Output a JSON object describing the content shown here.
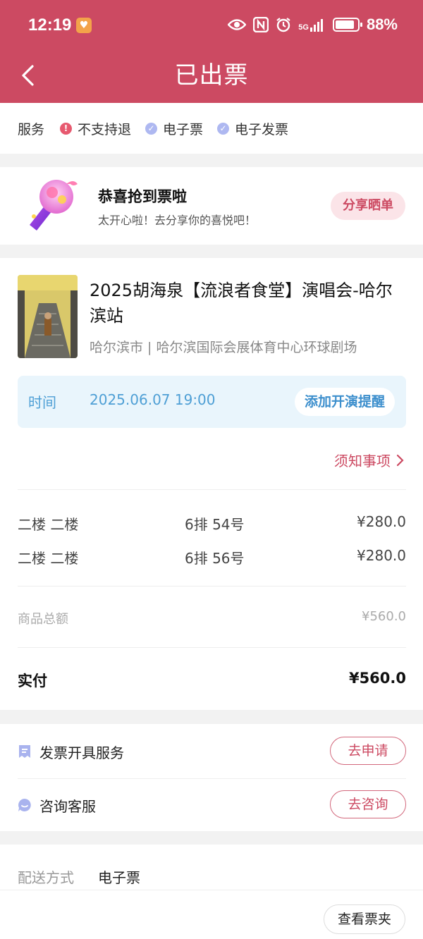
{
  "status_bar": {
    "time": "12:19",
    "network": "5G",
    "battery_percent": "88%",
    "battery_level": 0.88
  },
  "nav": {
    "title": "已出票",
    "back_icon": "chevron-left-icon"
  },
  "services_bar": {
    "label": "服务",
    "items": [
      {
        "text": "不支持退",
        "icon": "alert-icon",
        "color": "#e7596f"
      },
      {
        "text": "电子票",
        "icon": "check-icon",
        "color": "#aeb8f1"
      },
      {
        "text": "电子发票",
        "icon": "check-icon",
        "color": "#aeb8f1"
      }
    ]
  },
  "congrats": {
    "title": "恭喜抢到票啦",
    "subtitle": "太开心啦！去分享你的喜悦吧！",
    "share_button": "分享晒单"
  },
  "order": {
    "title": "2025胡海泉【流浪者食堂】演唱会-哈尔滨站",
    "venue": "哈尔滨市 | 哈尔滨国际会展体育中心环球剧场",
    "time_label": "时间",
    "time_value": "2025.06.07 19:00",
    "reminder_button": "添加开演提醒",
    "notice_link": "须知事项",
    "tickets": [
      {
        "zone": "二楼 二楼",
        "seat": "6排 54号",
        "price": "¥280.0"
      },
      {
        "zone": "二楼 二楼",
        "seat": "6排 56号",
        "price": "¥280.0"
      }
    ],
    "subtotal_label": "商品总额",
    "subtotal_value": "¥560.0",
    "paid_label": "实付",
    "paid_value": "¥560.0"
  },
  "service_rows": [
    {
      "label": "发票开具服务",
      "icon": "invoice-icon",
      "button": "去申请"
    },
    {
      "label": "咨询客服",
      "icon": "chat-icon",
      "button": "去咨询"
    }
  ],
  "delivery": {
    "label": "配送方式",
    "value": "电子票",
    "wallet_button": "查看票夹"
  },
  "colors": {
    "brand": "#cc4a62",
    "time_blue": "#4e9fd5",
    "page_bg": "#f2f2f2"
  }
}
